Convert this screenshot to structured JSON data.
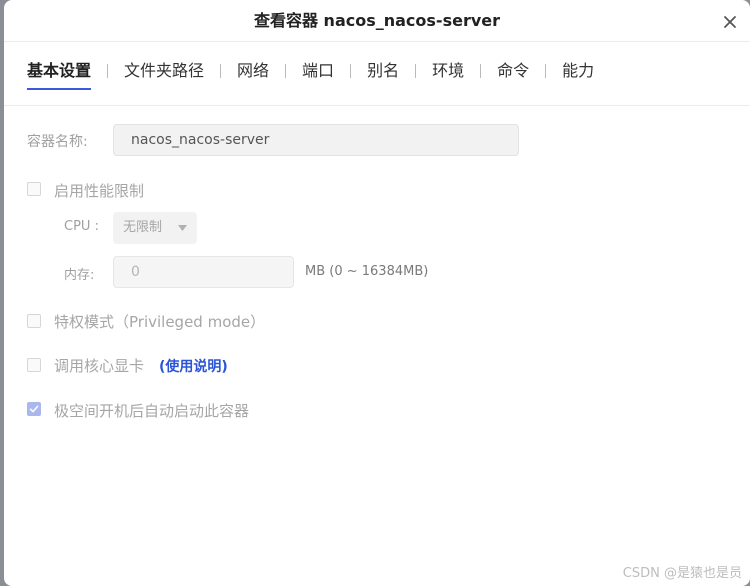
{
  "dialog": {
    "title": "查看容器 nacos_nacos-server"
  },
  "tabs": [
    {
      "label": "基本设置",
      "active": true
    },
    {
      "label": "文件夹路径"
    },
    {
      "label": "网络"
    },
    {
      "label": "端口"
    },
    {
      "label": "别名"
    },
    {
      "label": "环境"
    },
    {
      "label": "命令"
    },
    {
      "label": "能力"
    }
  ],
  "form": {
    "container_name_label": "容器名称:",
    "container_name_value": "nacos_nacos-server",
    "limit_checkbox_label": "启用性能限制",
    "limit_checked": false,
    "cpu_label": "CPU :",
    "cpu_value": "无限制",
    "memory_label": "内存:",
    "memory_value": "0",
    "memory_unit": "MB (0 ~ 16384MB)",
    "privileged_label": "特权模式（Privileged mode）",
    "privileged_checked": false,
    "gpu_label": "调用核心显卡",
    "gpu_help_link": "(使用说明)",
    "gpu_checked": false,
    "autostart_label": "极空间开机后自动启动此容器",
    "autostart_checked": true
  },
  "watermark": "CSDN @是猿也是员",
  "colors": {
    "accent": "#3b5bdb",
    "link": "#2b54d6",
    "checked_box": "#a9b7ee"
  }
}
